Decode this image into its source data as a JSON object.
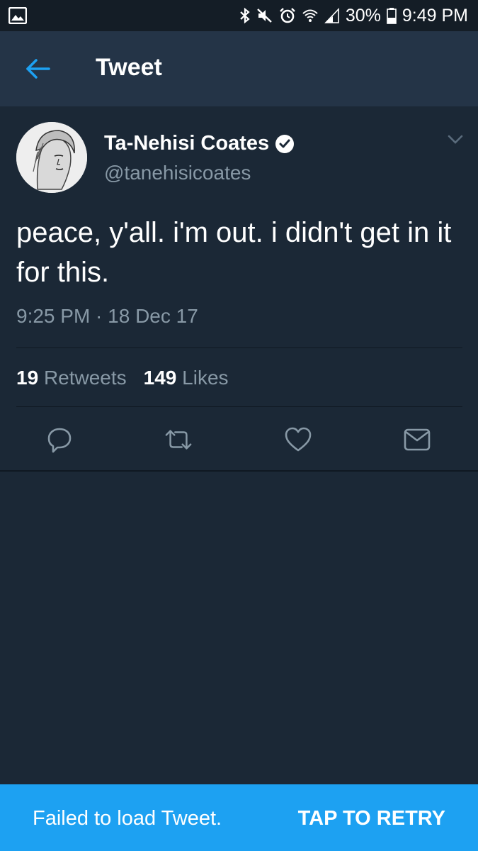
{
  "status_bar": {
    "battery": "30%",
    "time": "9:49 PM",
    "icons": [
      "image-icon",
      "bluetooth-icon",
      "mute-icon",
      "alarm-icon",
      "wifi-icon",
      "signal-icon",
      "battery-icon"
    ]
  },
  "app_bar": {
    "title": "Tweet",
    "back_icon": "arrow-left-icon"
  },
  "tweet": {
    "author_name": "Ta-Nehisi Coates",
    "verified": true,
    "handle": "@tanehisicoates",
    "text": "peace, y'all. i'm out. i didn't get in it for this.",
    "timestamp": "9:25 PM · 18 Dec 17",
    "retweets_count": "19",
    "retweets_label": "Retweets",
    "likes_count": "149",
    "likes_label": "Likes",
    "actions": [
      "reply-icon",
      "retweet-icon",
      "like-icon",
      "direct-message-icon"
    ]
  },
  "snackbar": {
    "message": "Failed to load Tweet.",
    "action": "TAP TO RETRY"
  },
  "colors": {
    "background": "#1b2836",
    "app_bar": "#243447",
    "status_bar": "#141d26",
    "accent": "#1da1f2",
    "secondary_text": "#8899a6"
  }
}
